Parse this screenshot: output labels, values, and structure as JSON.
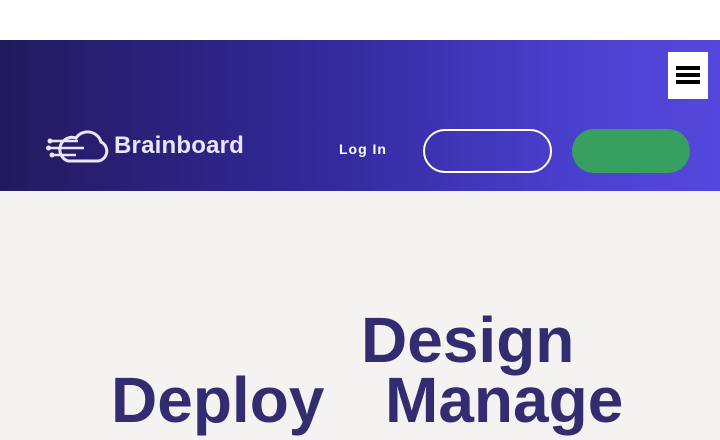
{
  "header": {
    "logo_text": "Brainboard",
    "login_label": "Log In",
    "outline_button_label": "",
    "primary_button_label": "",
    "menu_icon": "hamburger-menu-icon",
    "gradient_start": "#221a5e",
    "gradient_end": "#5647dc",
    "primary_button_color": "#37a060"
  },
  "hero": {
    "word1": "Design",
    "word2": "Deploy",
    "word3": "Manage",
    "title_color": "#332c70"
  }
}
